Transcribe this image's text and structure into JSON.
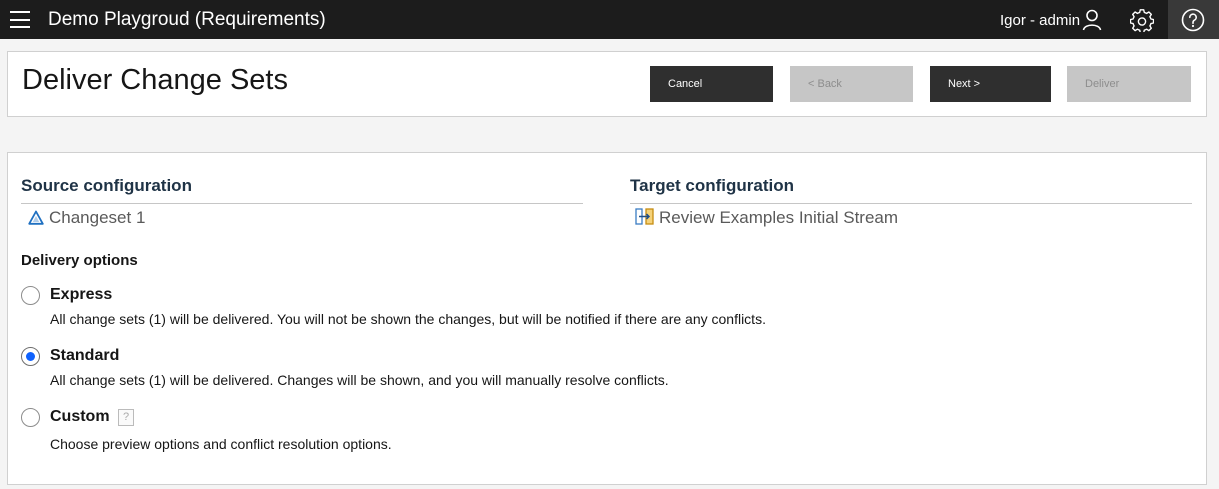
{
  "topbar": {
    "app_title": "Demo Playgroud (Requirements)",
    "user_label": "Igor - admin",
    "icons": [
      "menu-icon",
      "user-icon",
      "gear-icon",
      "help-icon"
    ]
  },
  "header": {
    "title": "Deliver Change Sets",
    "buttons": {
      "cancel": "Cancel",
      "back": "< Back",
      "next": "Next >",
      "deliver": "Deliver"
    }
  },
  "source": {
    "heading": "Source configuration",
    "item": "Changeset 1",
    "icon": "changeset-delta-icon"
  },
  "target": {
    "heading": "Target configuration",
    "item": "Review Examples Initial Stream",
    "icon": "stream-icon"
  },
  "delivery": {
    "heading": "Delivery options",
    "selected": "Standard",
    "options": [
      {
        "label": "Express",
        "description": "All change sets (1) will be delivered. You will not be shown the changes, but will be notified if there are any conflicts."
      },
      {
        "label": "Standard",
        "description": "All change sets (1) will be delivered. Changes will be shown, and you will manually resolve conflicts."
      },
      {
        "label": "Custom",
        "description": "Choose preview options and conflict resolution options.",
        "help_glyph": "?"
      }
    ]
  },
  "colors": {
    "topbar_bg": "#1c1c1c",
    "primary_button": "#2f2f2f",
    "disabled_button": "#c6c6c6",
    "radio_selected": "#0f62fe",
    "section_heading": "#1f3346"
  }
}
